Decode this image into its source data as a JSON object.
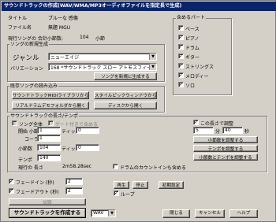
{
  "window": {
    "title": "サウンドトラックの作成(WAV/WMA/MP3オーディオファイルを指定長で生成)"
  },
  "info": {
    "title_label": "タイトル",
    "title_value": "ブルーな 感傷",
    "filename_label": "ファイル名",
    "filename_value": "無題 MGU",
    "total_bars_label": "現行ソングの 合計小節数:",
    "total_bars_value": "104",
    "total_bars_unit": "小節"
  },
  "new_generation": {
    "group_label": "ソングの新規生成",
    "genre_label": "ジャンル",
    "genre_value": "ニューエイジ",
    "variation_label": "バリエーション",
    "variation_value": "168 *サウンドトラック スロー アトモスフィール",
    "create_button": "ソングを新規に生成する"
  },
  "load_existing": {
    "group_label": "既存ソングの読み込み",
    "open_midi": "サウンドトラックMIDIライブラリから開く",
    "open_style": "スタイルピックウィンドウから開く",
    "open_realdrum": "リアルドラムデモフォルダから開く",
    "open_disk": "ディスクから開く"
  },
  "parts": {
    "group_label": "含めるパート",
    "items": [
      {
        "label": "ベース",
        "checked": true
      },
      {
        "label": "ピアノ",
        "checked": true
      },
      {
        "label": "ドラム",
        "checked": true
      },
      {
        "label": "ギター",
        "checked": true
      },
      {
        "label": "ストリングス",
        "checked": true
      },
      {
        "label": "メロディー",
        "checked": true
      },
      {
        "label": "ソロ",
        "checked": true
      }
    ]
  },
  "length_tempo": {
    "group_label": "サウンドトラックの長さ/テンポ",
    "whole_song_label": "ソング全体",
    "whole_song_checked": false,
    "bar_specified_label": "ゲート付きで含める",
    "bar_specified_checked": false,
    "start_bar_label": "開始 小節",
    "start_bar_value": "1",
    "tick_label": "ティック",
    "tick_value": "0",
    "chorus_label": "コーラス",
    "chorus_value": "1",
    "bar_count_label": "小節数",
    "bar_count_value": "104",
    "tick2_label": "ティック",
    "tick2_value": "0",
    "tempo_label": "テンポ",
    "tempo_value": "140",
    "current_length_label": "現行の 長さ",
    "current_length_value": "2m58.28sec",
    "drum_count_in_label": "ドラムのカウントインも含める",
    "drum_count_in_checked": false,
    "set_length_label": "この長さで調整",
    "set_length_checked": true,
    "minutes_value": "5",
    "minutes_unit": "分",
    "seconds_value": "40",
    "seconds_unit": "秒",
    "adjust_bars_button": "小節数を調整する",
    "adjust_tempo_button": "テンポを調整する",
    "adjust_both_button": "小節数とテンポを調整する"
  },
  "fades": {
    "fade_in_label": "フェードイン (秒)",
    "fade_in_checked": true,
    "fade_in_value": "2",
    "fade_out_label": "フェードアウト (秒)",
    "fade_out_checked": true,
    "fade_out_value": "2"
  },
  "playback": {
    "play_button": "再生",
    "stop_button": "停止",
    "loop_label": "ループ",
    "loop_checked": true,
    "reset_button": "初期設定"
  },
  "footer": {
    "trial_button": "試聴",
    "make_button": "サウンドトラックを作成する",
    "format_value": "WAV",
    "close_button": "閉じる",
    "cancel_button": "キャンセル",
    "help_button": "ヘルプ"
  }
}
